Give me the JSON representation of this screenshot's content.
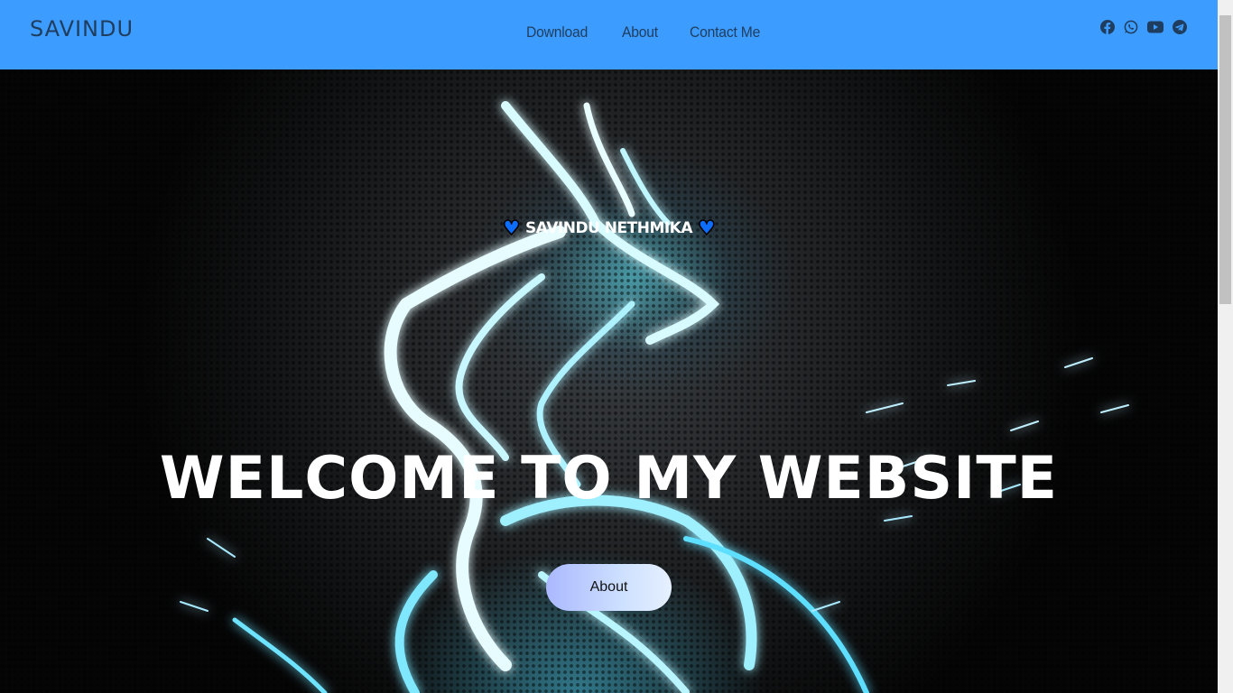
{
  "navbar": {
    "brand": "SAVINDU",
    "links": [
      {
        "label": "Download"
      },
      {
        "label": "About"
      },
      {
        "label": "Contact Me"
      }
    ],
    "socials": [
      "facebook-icon",
      "whatsapp-icon",
      "youtube-icon",
      "telegram-icon"
    ]
  },
  "hero": {
    "subtitle": "SAVINDU NETHMIKA",
    "subtitle_icon": "blue-heart-icon",
    "headline": "WELCOME TO MY WEBSITE",
    "button_label": "About"
  },
  "colors": {
    "navbar_bg": "#3d9cff",
    "nav_text": "#1f3d5e",
    "accent_glow": "#5aebff",
    "heart": "#0d6efd"
  }
}
